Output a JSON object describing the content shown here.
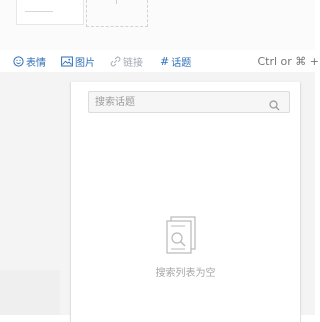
{
  "toolbar": {
    "emoji": {
      "label": "表情",
      "icon": "smiley-icon"
    },
    "image": {
      "label": "图片",
      "icon": "image-icon"
    },
    "link": {
      "label": "链接",
      "icon": "link-icon"
    },
    "topic": {
      "label": "话题",
      "icon": "hash-icon",
      "symbol": "#"
    },
    "shortcut_hint": "Ctrl or ⌘ +"
  },
  "topic_panel": {
    "search_placeholder": "搜索话题",
    "search_icon": "search-icon",
    "empty_icon": "empty-list-icon",
    "empty_text": "搜索列表为空"
  },
  "colors": {
    "accent": "#2f6fb6",
    "muted": "#9ea7b3",
    "border": "#dcdcdc",
    "backdrop": "#f4f4f4"
  }
}
